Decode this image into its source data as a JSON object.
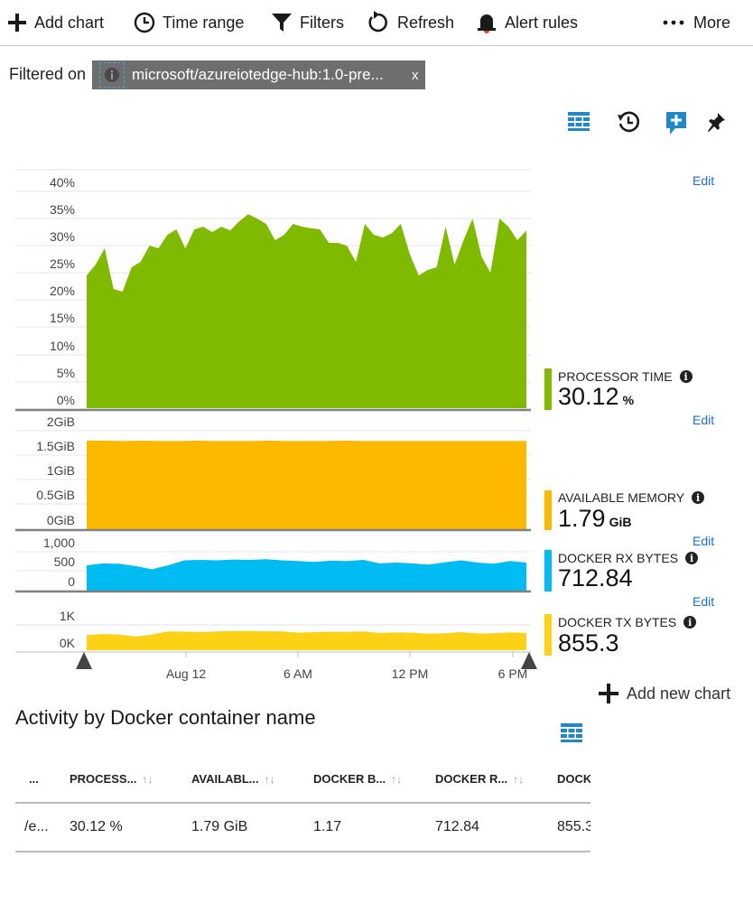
{
  "toolbar": {
    "add_chart": "Add chart",
    "time_range": "Time range",
    "filters": "Filters",
    "refresh": "Refresh",
    "alert_rules": "Alert rules",
    "more": "More"
  },
  "filter": {
    "label": "Filtered on",
    "chip_text": "microsoft/azureiotedge-hub:1.0-pre...",
    "chip_close": "x"
  },
  "chart_panel": {
    "edit_label": "Edit",
    "add_new_chart": "Add new chart",
    "x_ticks": [
      "Aug 12",
      "6 AM",
      "12 PM",
      "6 PM"
    ]
  },
  "chart_data": [
    {
      "type": "area",
      "name": "PROCESSOR TIME",
      "value": "30.12",
      "unit": "%",
      "color": "#7fba00",
      "y_ticks": [
        "40%",
        "35%",
        "30%",
        "25%",
        "20%",
        "15%",
        "10%",
        "5%",
        "0%"
      ],
      "ylim": [
        0,
        40
      ],
      "values": [
        24.5,
        26.5,
        29.5,
        22,
        21.5,
        26,
        27,
        30,
        29.5,
        32,
        33,
        29.5,
        33,
        33.5,
        32.5,
        33.5,
        32.8,
        34.5,
        35.8,
        35,
        34,
        31,
        32,
        34,
        33.5,
        33.2,
        33,
        30.5,
        30.5,
        30,
        27,
        34,
        32,
        31.5,
        32.3,
        34,
        28.5,
        24.5,
        25.5,
        26,
        33.5,
        26.5,
        31,
        35,
        28,
        25,
        35,
        33.5,
        31,
        32.8
      ]
    },
    {
      "type": "area",
      "name": "AVAILABLE MEMORY",
      "value": "1.79",
      "unit": "GiB",
      "color": "#fcb900",
      "y_ticks": [
        "2GiB",
        "1.5GiB",
        "1GiB",
        "0.5GiB",
        "0GiB"
      ],
      "ylim": [
        0,
        2
      ],
      "values": [
        1.8,
        1.8,
        1.79,
        1.8,
        1.79,
        1.79,
        1.8,
        1.79,
        1.79,
        1.79,
        1.8,
        1.79,
        1.79,
        1.79,
        1.8,
        1.79,
        1.79,
        1.79,
        1.79,
        1.79,
        1.79,
        1.79,
        1.79,
        1.79,
        1.79
      ]
    },
    {
      "type": "area",
      "name": "DOCKER RX BYTES",
      "value": "712.84",
      "unit": "",
      "color": "#00bcf2",
      "y_ticks": [
        "1,000",
        "500",
        "0"
      ],
      "ylim": [
        0,
        1000
      ],
      "values": [
        650,
        700,
        690,
        630,
        550,
        650,
        780,
        790,
        780,
        800,
        790,
        810,
        780,
        760,
        740,
        770,
        760,
        790,
        700,
        720,
        700,
        670,
        730,
        780,
        720,
        690,
        760,
        720
      ]
    },
    {
      "type": "area",
      "name": "DOCKER TX BYTES",
      "value": "855.3",
      "unit": "",
      "color": "#fcd116",
      "y_ticks": [
        "1K",
        "0K"
      ],
      "ylim": [
        0,
        1300
      ],
      "values": [
        780,
        830,
        800,
        700,
        800,
        960,
        950,
        930,
        960,
        990,
        990,
        970,
        960,
        900,
        930,
        950,
        940,
        960,
        880,
        920,
        900,
        850,
        870,
        930,
        860,
        870,
        920,
        880
      ]
    }
  ],
  "table": {
    "title": "Activity by Docker container name",
    "columns": [
      "...",
      "PROCESS...",
      "AVAILABL...",
      "DOCKER B...",
      "DOCKER R...",
      "DOCK"
    ],
    "rows": [
      [
        "/e...",
        "30.12 %",
        "1.79 GiB",
        "1.17",
        "712.84",
        "855.3"
      ]
    ]
  }
}
